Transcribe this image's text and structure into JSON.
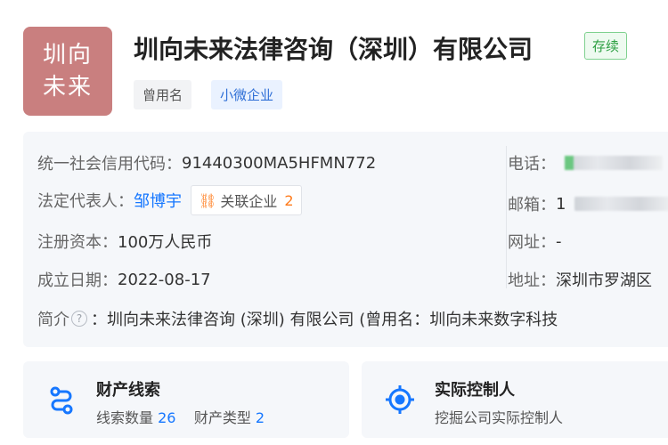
{
  "company": {
    "logo_line1": "圳向",
    "logo_line2": "未来",
    "name": "圳向未来法律咨询（深圳）有限公司",
    "status": "存续",
    "tags": [
      "曾用名",
      "小微企业"
    ]
  },
  "info": {
    "credit_code_label": "统一社会信用代码：",
    "credit_code": "91440300MA5HFMN772",
    "legal_rep_label": "法定代表人：",
    "legal_rep": "邹博宇",
    "related_label": "关联企业",
    "related_count": "2",
    "capital_label": "注册资本：",
    "capital": "100万人民币",
    "founded_label": "成立日期：",
    "founded": "2022-08-17",
    "intro_label": "简介",
    "intro_text": "：圳向未来法律咨询 (深圳) 有限公司 (曾用名：圳向未来数字科技",
    "phone_label": "电话：",
    "email_label": "邮箱：",
    "email_prefix": "1",
    "website_label": "网址：",
    "website": "-",
    "address_label": "地址：",
    "address": "深圳市罗湖区"
  },
  "cards": {
    "assets_title": "财产线索",
    "assets_clue_label": "线索数量",
    "assets_clue_count": "26",
    "assets_type_label": "财产类型",
    "assets_type_count": "2",
    "controller_title": "实际控制人",
    "controller_sub": "挖掘公司实际控制人"
  },
  "colors": {
    "logo_bg": "#c97f7f",
    "link": "#1677ff",
    "status_green": "#2ea043",
    "accent_orange": "#ff7a1a"
  }
}
